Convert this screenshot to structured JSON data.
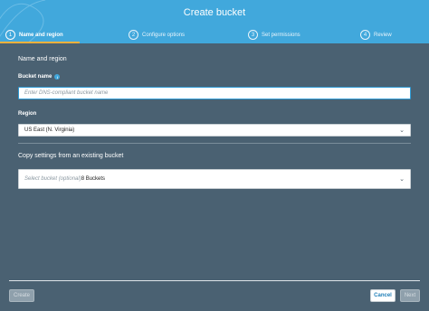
{
  "colors": {
    "header_bg": "#41a8dc",
    "page_bg": "#4a6172",
    "active_underline": "#f3b13c",
    "link_blue": "#1f7fb8"
  },
  "header": {
    "title": "Create bucket"
  },
  "steps": [
    {
      "number": "1",
      "label": "Name and region",
      "active": true
    },
    {
      "number": "2",
      "label": "Configure options",
      "active": false
    },
    {
      "number": "3",
      "label": "Set permissions",
      "active": false
    },
    {
      "number": "4",
      "label": "Review",
      "active": false
    }
  ],
  "form": {
    "section_title": "Name and region",
    "bucket_name": {
      "label": "Bucket name",
      "info_icon": "info-icon",
      "value": "",
      "placeholder": "Enter DNS-compliant bucket name"
    },
    "region": {
      "label": "Region",
      "selected": "US East (N. Virginia)"
    },
    "copy_settings": {
      "label": "Copy settings from an existing bucket",
      "placeholder": "Select bucket (optional)",
      "count_text": "8 Buckets"
    }
  },
  "footer": {
    "create_label": "Create",
    "cancel_label": "Cancel",
    "next_label": "Next"
  }
}
